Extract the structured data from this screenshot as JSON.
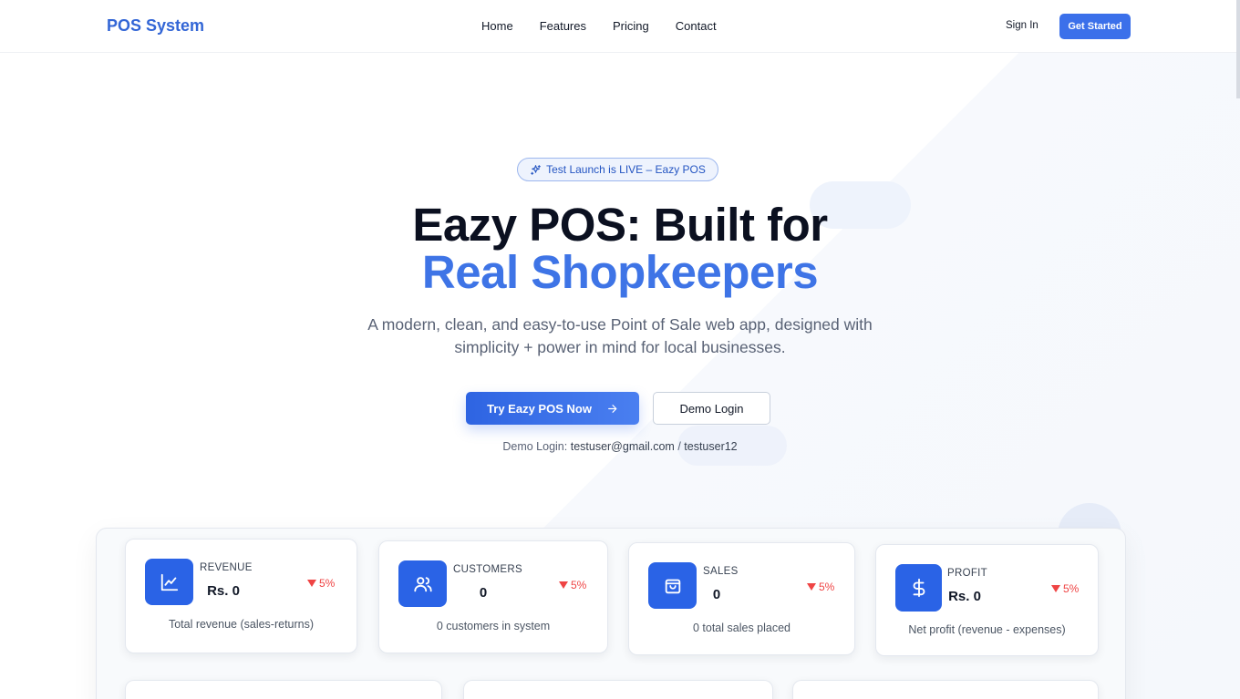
{
  "nav": {
    "logo": "POS System",
    "links": [
      "Home",
      "Features",
      "Pricing",
      "Contact"
    ],
    "sign_in": "Sign In",
    "get_started": "Get Started"
  },
  "hero": {
    "badge": "Test Launch is LIVE – Eazy POS",
    "title_line1": "Eazy POS: Built for",
    "title_line2": "Real Shopkeepers",
    "subtitle_line1": "A modern, clean, and easy-to-use Point of Sale web app, designed with",
    "subtitle_line2": "simplicity + power in mind for local businesses.",
    "primary_button": "Try Eazy POS Now",
    "secondary_button": "Demo Login",
    "demo_label": "Demo Login: ",
    "demo_email": "testuser@gmail.com",
    "demo_separator": " / ",
    "demo_password": "testuser12"
  },
  "stats": [
    {
      "label": "REVENUE",
      "value": "Rs. 0",
      "change": "5%",
      "description": "Total revenue (sales-returns)",
      "icon": "chart-line-icon"
    },
    {
      "label": "CUSTOMERS",
      "value": "0",
      "change": "5%",
      "description": "0 customers in system",
      "icon": "users-icon"
    },
    {
      "label": "SALES",
      "value": "0",
      "change": "5%",
      "description": "0 total sales placed",
      "icon": "shopping-bag-icon"
    },
    {
      "label": "PROFIT",
      "value": "Rs. 0",
      "change": "5%",
      "description": "Net profit (revenue - expenses)",
      "icon": "dollar-icon"
    }
  ],
  "colors": {
    "brand": "#3b70ea",
    "heading_accent": "#3e74e6",
    "negative": "#ef4444"
  }
}
